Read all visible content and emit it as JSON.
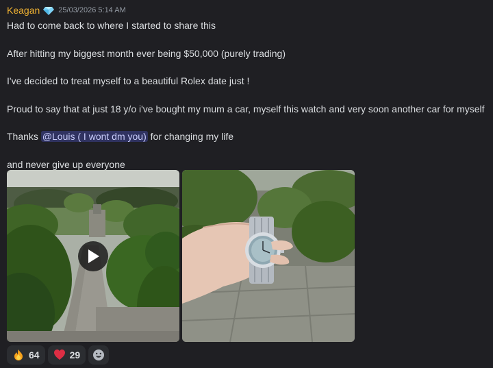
{
  "message": {
    "author": "Keagan",
    "badge_icon": "diamond-icon",
    "timestamp": "25/03/2026 5:14 AM",
    "lines": {
      "l1": "Had to come back to where I started to share this",
      "l2": "After hitting my biggest month ever being $50,000 (purely trading)",
      "l3": "I've decided to treat myself to a beautiful Rolex date just !",
      "l4": "Proud to say that at just 18 y/o i've bought my mum a car, myself this watch and very soon another car for myself",
      "l5_prefix": "Thanks ",
      "l5_mention": "@Louis ( I wont dm you)",
      "l5_suffix": " for changing my life",
      "l6": "and never give up everyone"
    }
  },
  "attachments": [
    {
      "kind": "video",
      "icon": "play-icon"
    },
    {
      "kind": "image"
    }
  ],
  "reactions": [
    {
      "emoji": "fire-icon",
      "count": "64"
    },
    {
      "emoji": "heart-icon",
      "count": "29"
    },
    {
      "emoji": "add-reaction-icon"
    }
  ],
  "colors": {
    "author": "#f0b232",
    "background": "#1f1f23",
    "mention_bg": "#3a3f74"
  }
}
